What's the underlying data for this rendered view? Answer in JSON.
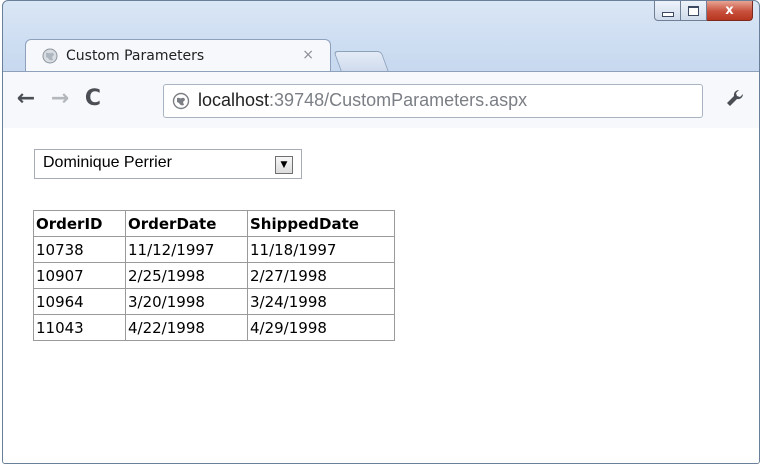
{
  "window": {
    "caption_buttons": {
      "minimize": "minimize",
      "maximize": "maximize",
      "close": "x"
    }
  },
  "tab": {
    "title": "Custom Parameters",
    "close": "×",
    "favicon": "globe-icon"
  },
  "toolbar": {
    "back": "←",
    "forward": "→",
    "reload": "C",
    "url_host": "localhost",
    "url_path": ":39748/CustomParameters.aspx",
    "menu_icon": "wrench-icon"
  },
  "form": {
    "dropdown_selected": "Dominique Perrier"
  },
  "grid": {
    "headers": [
      "OrderID",
      "OrderDate",
      "ShippedDate"
    ],
    "rows": [
      [
        "10738",
        "11/12/1997",
        "11/18/1997"
      ],
      [
        "10907",
        "2/25/1998",
        "2/27/1998"
      ],
      [
        "10964",
        "3/20/1998",
        "3/24/1998"
      ],
      [
        "11043",
        "4/22/1998",
        "4/29/1998"
      ]
    ]
  }
}
